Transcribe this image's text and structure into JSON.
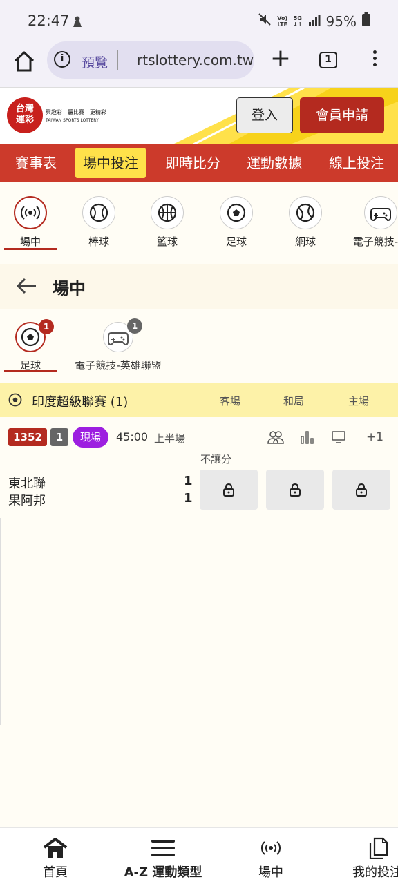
{
  "status": {
    "time": "22:47",
    "battery": "95%",
    "volte_top": "Vo)",
    "volte_bottom": "LTE",
    "net_top": "5G",
    "net_bottom": "↓↑"
  },
  "browser": {
    "preview_label": "預覽",
    "url": "rtslottery.com.tw",
    "tab_count": "1"
  },
  "header": {
    "logo_text_line1": "台灣",
    "logo_text_line2": "運彩",
    "logo_caption_cn": "興趣彩　體比賽　更精彩",
    "logo_caption_en": "TAIWAN SPORTS LOTTERY",
    "login_label": "登入",
    "register_label": "會員申請"
  },
  "nav": {
    "items": [
      "賽事表",
      "場中投注",
      "即時比分",
      "運動數據",
      "線上投注"
    ]
  },
  "sports": {
    "items": [
      {
        "label": "場中",
        "icon": "live-icon"
      },
      {
        "label": "棒球",
        "icon": "baseball-icon"
      },
      {
        "label": "籃球",
        "icon": "basketball-icon"
      },
      {
        "label": "足球",
        "icon": "soccer-icon"
      },
      {
        "label": "網球",
        "icon": "tennis-icon"
      },
      {
        "label": "電子競技-英",
        "icon": "gamepad-icon"
      }
    ]
  },
  "page": {
    "title": "場中"
  },
  "subtabs": {
    "items": [
      {
        "label": "足球",
        "count": "1",
        "badge_color": "#b42a1f"
      },
      {
        "label": "電子競技-英雄聯盟",
        "count": "1",
        "badge_color": "#666666"
      }
    ]
  },
  "league": {
    "name": "印度超級聯賽 (1)",
    "columns": [
      "客場",
      "和局",
      "主場"
    ]
  },
  "match": {
    "id": "1352",
    "number": "1",
    "live_label": "現場",
    "clock": "45:00",
    "period": "上半場",
    "more_markets": "+1",
    "market_label": "不讓分",
    "teams": [
      {
        "name": "東北聯",
        "score": "1"
      },
      {
        "name": "果阿邦",
        "score": "1"
      }
    ]
  },
  "bottom_nav": {
    "items": [
      "首頁",
      "A-Z 運動類型",
      "場中",
      "我的投注"
    ]
  },
  "colors": {
    "brand_red": "#b42a1f",
    "nav_red": "#cc3a2b",
    "active_yellow": "#ffe14a",
    "league_yellow": "#fdf2a8",
    "live_purple": "#9d1fe0"
  }
}
